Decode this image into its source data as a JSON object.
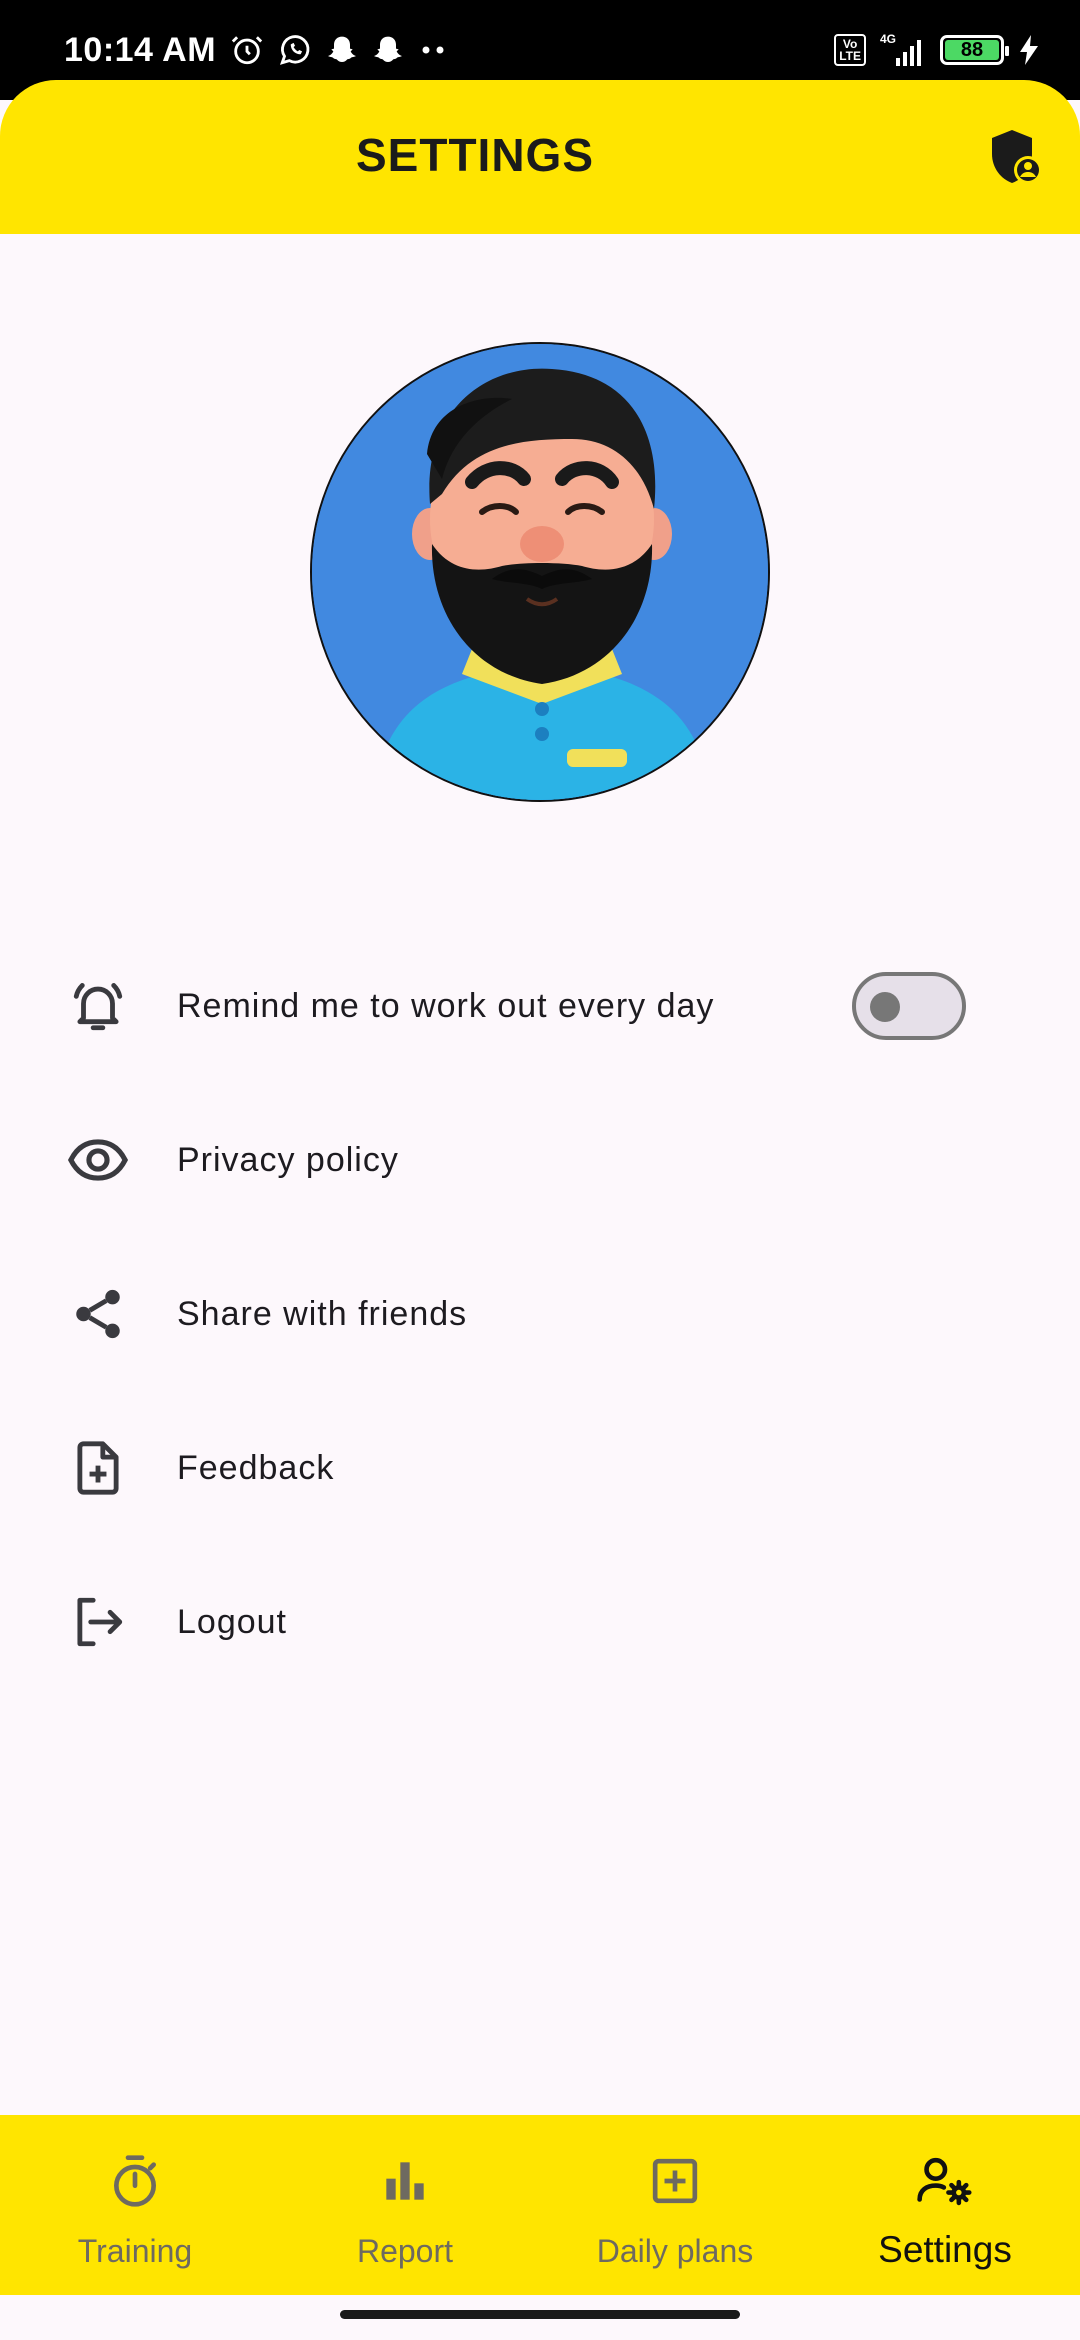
{
  "status_bar": {
    "time": "10:14 AM",
    "battery_level": "88",
    "network_label": "4G",
    "volte_label": "Vo LTE",
    "icons": [
      "alarm-icon",
      "whatsapp-icon",
      "snapchat-icon",
      "snapchat-icon",
      "more-dots-icon",
      "signal-icon",
      "battery-icon",
      "charging-icon"
    ]
  },
  "app_bar": {
    "title": "SETTINGS",
    "action_icon": "shield-user-icon"
  },
  "profile": {
    "avatar_icon": "avatar-illustration"
  },
  "menu": {
    "items": [
      {
        "label": "Remind me to work out every day",
        "icon": "alarm-bell-icon",
        "toggle": false
      },
      {
        "label": "Privacy policy",
        "icon": "eye-icon"
      },
      {
        "label": "Share with friends",
        "icon": "share-icon"
      },
      {
        "label": "Feedback",
        "icon": "file-add-icon"
      },
      {
        "label": "Logout",
        "icon": "logout-icon"
      }
    ]
  },
  "bottom_nav": {
    "items": [
      {
        "label": "Training",
        "icon": "stopwatch-icon"
      },
      {
        "label": "Report",
        "icon": "bar-chart-icon"
      },
      {
        "label": "Daily plans",
        "icon": "add-box-icon"
      },
      {
        "label": "Settings",
        "icon": "user-settings-icon",
        "active": true
      }
    ]
  },
  "colors": {
    "accent": "#ffe500",
    "background": "#fdf8fc",
    "avatar_bg": "#4189e0",
    "text": "#1d1b20",
    "inactive_nav": "#6e6a60"
  }
}
